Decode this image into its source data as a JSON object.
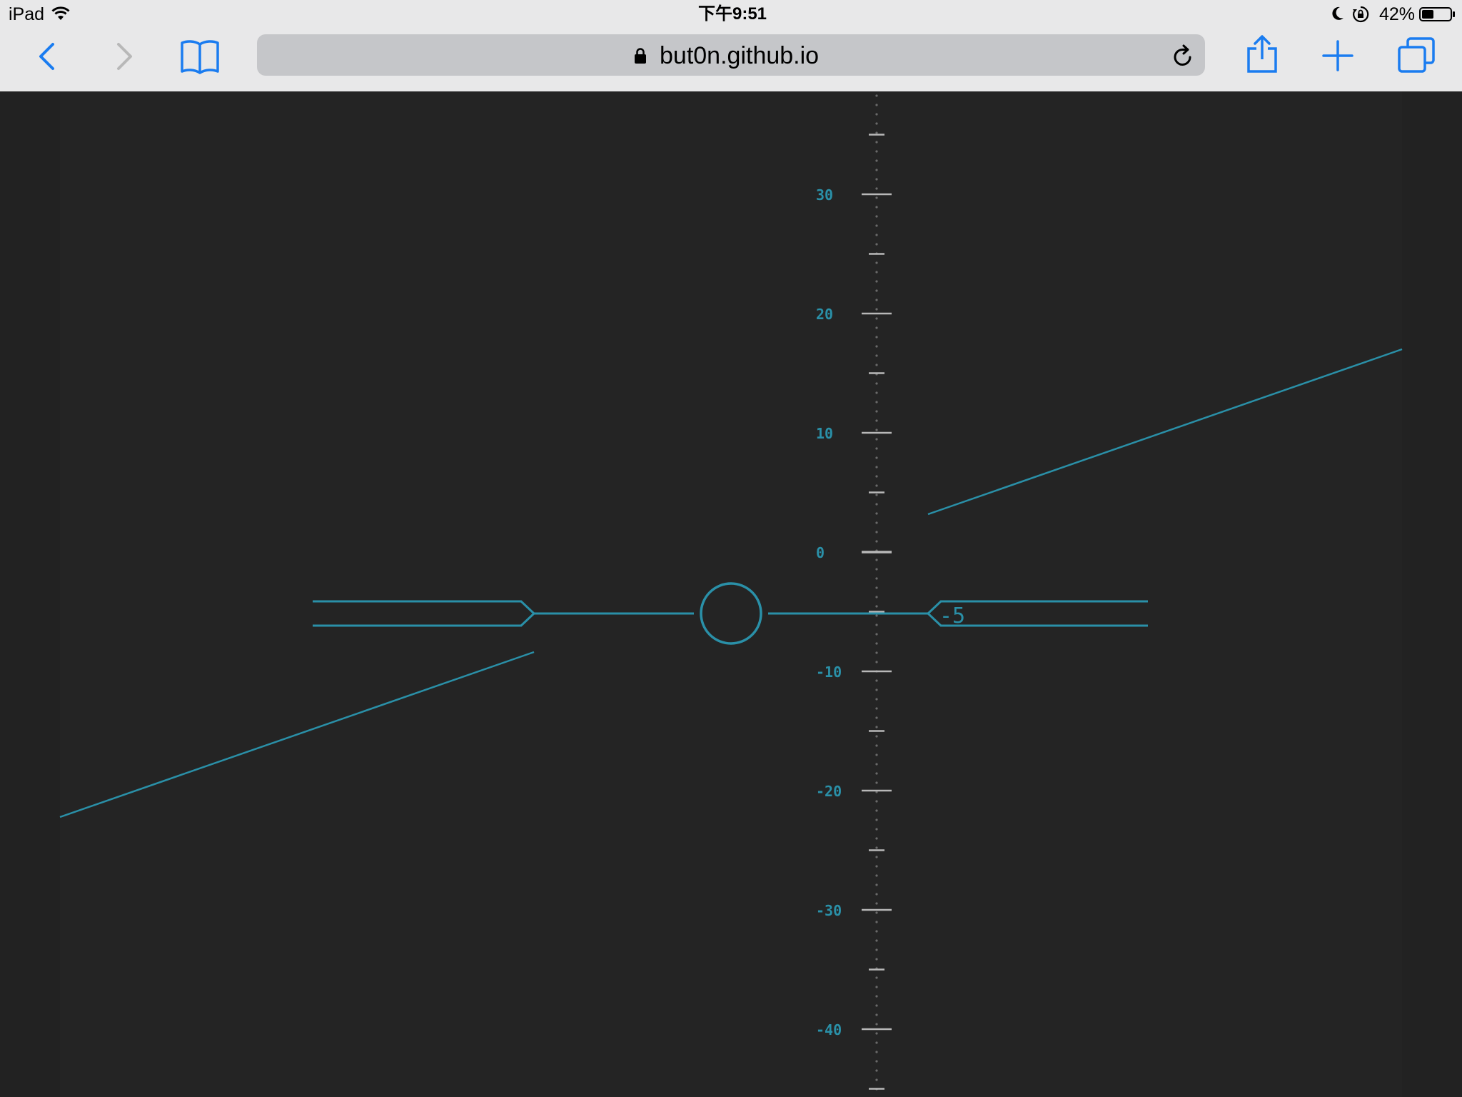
{
  "status_bar": {
    "device": "iPad",
    "time": "下午9:51",
    "battery_percent": "42%",
    "battery_level": 0.42,
    "icons": [
      "wifi-icon",
      "moon-icon",
      "rotation-lock-icon",
      "battery-icon"
    ]
  },
  "toolbar": {
    "url": "but0n.github.io",
    "icons": [
      "back-icon",
      "forward-icon",
      "bookmarks-icon",
      "lock-icon",
      "reload-icon",
      "share-icon",
      "new-tab-icon",
      "tabs-icon"
    ]
  },
  "hud": {
    "pitch_ticks": [
      {
        "label": "30",
        "value": 30
      },
      {
        "label": "20",
        "value": 20
      },
      {
        "label": "10",
        "value": 10
      },
      {
        "label": "0",
        "value": 0
      },
      {
        "label": "-10",
        "value": -10
      },
      {
        "label": "-20",
        "value": -20
      },
      {
        "label": "-30",
        "value": -30
      },
      {
        "label": "-40",
        "value": -40
      }
    ],
    "pitch_readout": "-5",
    "pitch_value": -5
  },
  "colors": {
    "hud": "#2a90a8",
    "tick": "#b8b8b8",
    "background": "#242424",
    "accent": "#1a7cf0"
  }
}
